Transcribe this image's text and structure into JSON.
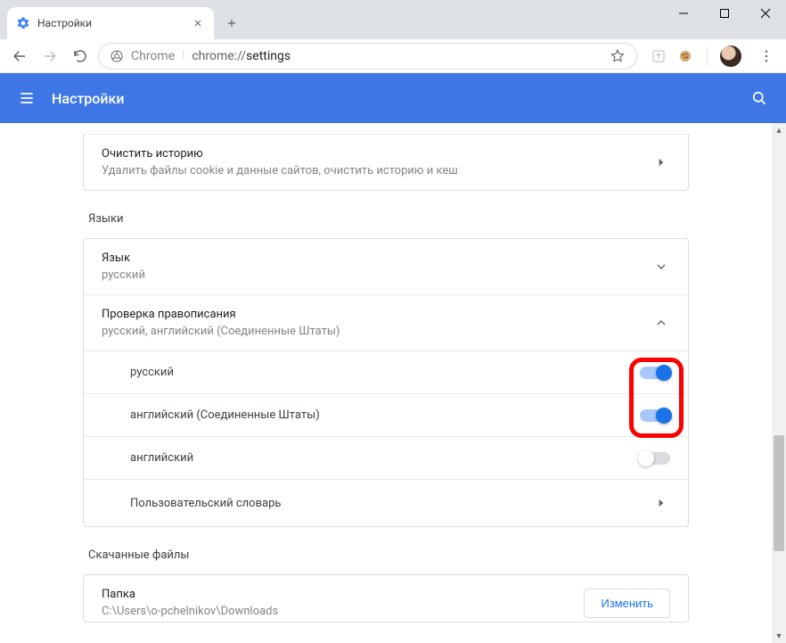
{
  "window": {
    "tab_title": "Настройки"
  },
  "omnibox": {
    "chrome_label": "Chrome",
    "scheme": "chrome://",
    "path": "settings"
  },
  "header": {
    "title": "Настройки"
  },
  "clear_history": {
    "title": "Очистить историю",
    "sub": "Удалить файлы cookie и данные сайтов, очистить историю и кеш"
  },
  "languages": {
    "section_label": "Языки",
    "language_row": {
      "title": "Язык",
      "sub": "русский"
    },
    "spellcheck_row": {
      "title": "Проверка правописания",
      "sub": "русский, английский (Соединенные Штаты)"
    },
    "items": [
      {
        "label": "русский",
        "on": true
      },
      {
        "label": "английский (Соединенные Штаты)",
        "on": true
      },
      {
        "label": "английский",
        "on": false
      }
    ],
    "custom_dict": "Пользовательский словарь"
  },
  "downloads": {
    "section_label": "Скачанные файлы",
    "folder_title": "Папка",
    "folder_sub": "C:\\Users\\o-pchelnikov\\Downloads",
    "change_btn": "Изменить"
  }
}
